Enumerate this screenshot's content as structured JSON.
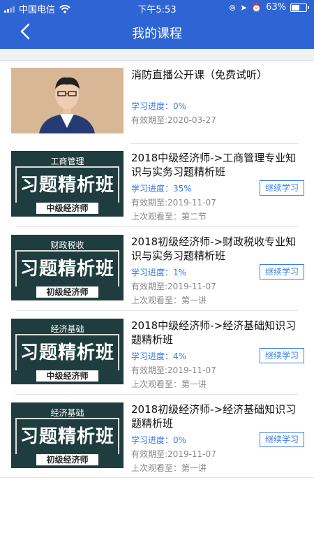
{
  "status": {
    "carrier": "中国电信",
    "time": "下午5:53",
    "battery": "63%",
    "battery_level": 0.63
  },
  "nav": {
    "title": "我的课程"
  },
  "course_progress_label": "学习进度：",
  "continue_label": "继续学习",
  "courses": [
    {
      "title": "消防直播公开课（免费试听）",
      "progress": "学习进度：0%",
      "expiry": "有效期至:2020-03-27",
      "thumb_type": "photo"
    },
    {
      "title": "2018中级经济师->工商管理专业知识与实务习题精析班",
      "progress": "学习进度：35%",
      "expiry": "有效期至:2019-11-07",
      "last": "上次观看至：第二节",
      "thumb": {
        "tag": "工商管理",
        "big": "习题精析班",
        "level": "中级经济师"
      }
    },
    {
      "title": "2018初级经济师->财政税收专业知识与实务习题精析班",
      "progress": "学习进度：1%",
      "expiry": "有效期至:2019-11-07",
      "last": "上次观看至：第一讲",
      "thumb": {
        "tag": "财政税收",
        "big": "习题精析班",
        "level": "初级经济师"
      }
    },
    {
      "title": "2018中级经济师->经济基础知识习题精析班",
      "progress": "学习进度：4%",
      "expiry": "有效期至:2019-11-07",
      "last": "上次观看至：第一讲",
      "thumb": {
        "tag": "经济基础",
        "big": "习题精析班",
        "level": "中级经济师"
      }
    },
    {
      "title": "2018初级经济师->经济基础知识习题精析班",
      "progress": "学习进度：0%",
      "expiry": "有效期至:2019-11-07",
      "last": "上次观看至：第一讲",
      "thumb": {
        "tag": "经济基础",
        "big": "习题精析班",
        "level": "初级经济师"
      }
    }
  ]
}
